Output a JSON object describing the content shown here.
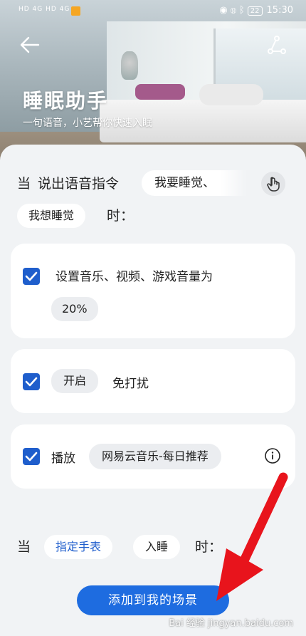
{
  "status_bar": {
    "left_text": "HD 4G HD 4G",
    "battery": "22",
    "time": "15:30"
  },
  "header": {
    "title": "睡眠助手",
    "subtitle": "一句语音，小艺帮你快速入眠"
  },
  "condition": {
    "when": "当",
    "say_command": "说出语音指令",
    "phrase_1": "我要睡觉、",
    "phrase_2": "我想睡觉",
    "suffix": "时："
  },
  "actions": [
    {
      "checked": true,
      "text": "设置音乐、视频、游戏音量为",
      "value": "20%"
    },
    {
      "checked": true,
      "chip": "开启",
      "text": "免打扰"
    },
    {
      "checked": true,
      "text": "播放",
      "chip": "网易云音乐-每日推荐"
    }
  ],
  "trigger": {
    "when": "当",
    "device": "指定手表",
    "state": "入睡",
    "suffix": "时："
  },
  "add_button_label": "添加到我的场景",
  "watermark": "Bai 经验 jingyan.baidu.com",
  "colors": {
    "accent": "#1e6ce0",
    "checkbox": "#1f5ecc",
    "annotation_arrow": "#e8141c"
  },
  "icons": {
    "back": "back-arrow-icon",
    "share": "share-icon",
    "touch": "touch-hand-icon",
    "info": "info-icon"
  }
}
